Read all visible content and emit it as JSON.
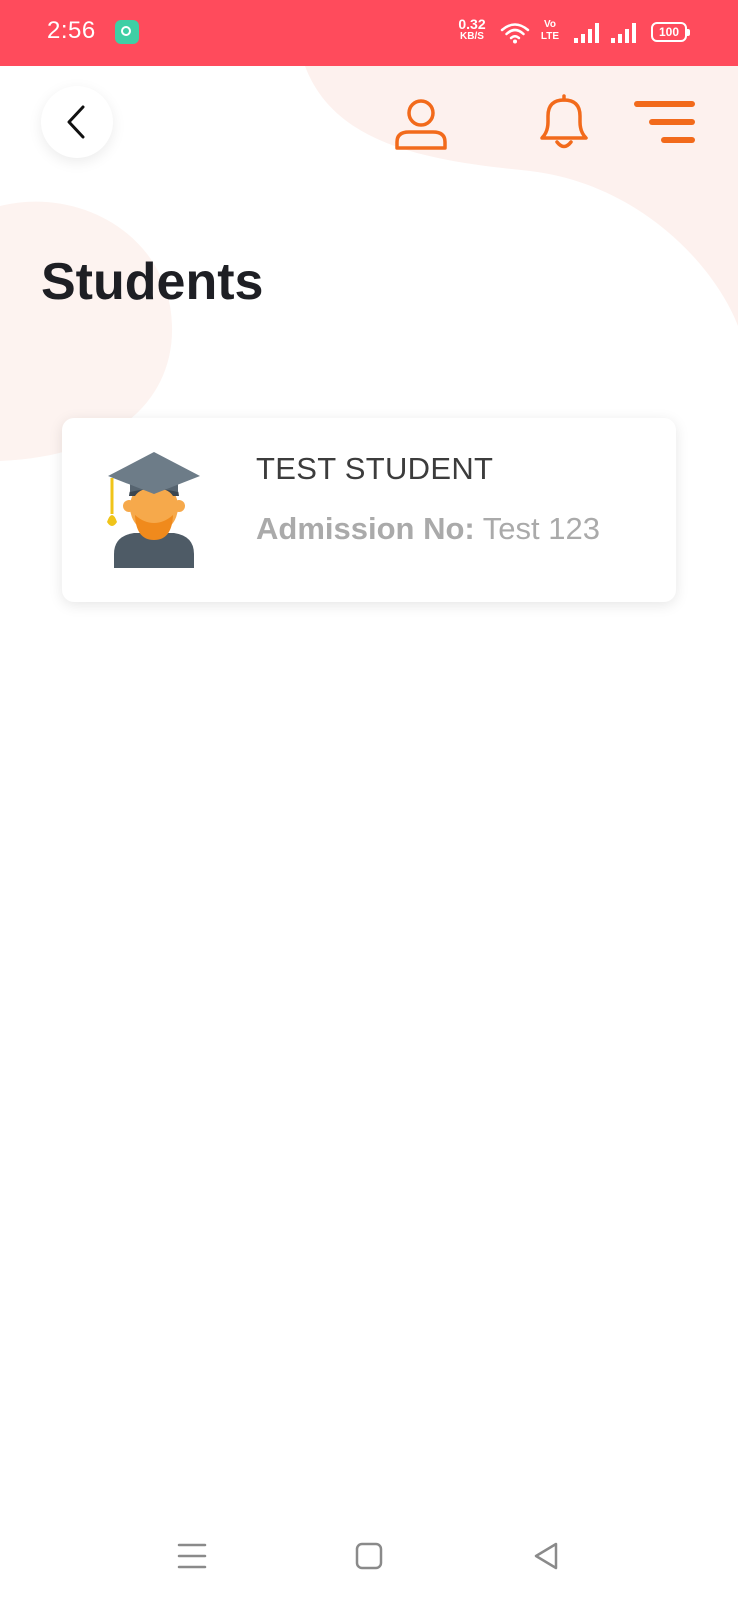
{
  "status_bar": {
    "time": "2:56",
    "net_speed_value": "0.32",
    "net_speed_unit": "KB/S",
    "volte_line1": "Vo",
    "volte_line2": "LTE",
    "battery_level": "100",
    "color": "#ff4b5c"
  },
  "header": {
    "back_icon": "chevron-left-icon",
    "profile_icon": "user-icon",
    "notification_icon": "bell-icon",
    "menu_icon": "menu-icon",
    "accent_color": "#f26a1b"
  },
  "page": {
    "title": "Students"
  },
  "students": [
    {
      "name": "TEST STUDENT",
      "admission_label": "Admission No:",
      "admission_value": "Test 123",
      "avatar_icon": "graduate-student-icon"
    }
  ],
  "nav_bar": {
    "recents_icon": "recents-icon",
    "home_icon": "home-icon",
    "back_icon": "back-triangle-icon"
  }
}
